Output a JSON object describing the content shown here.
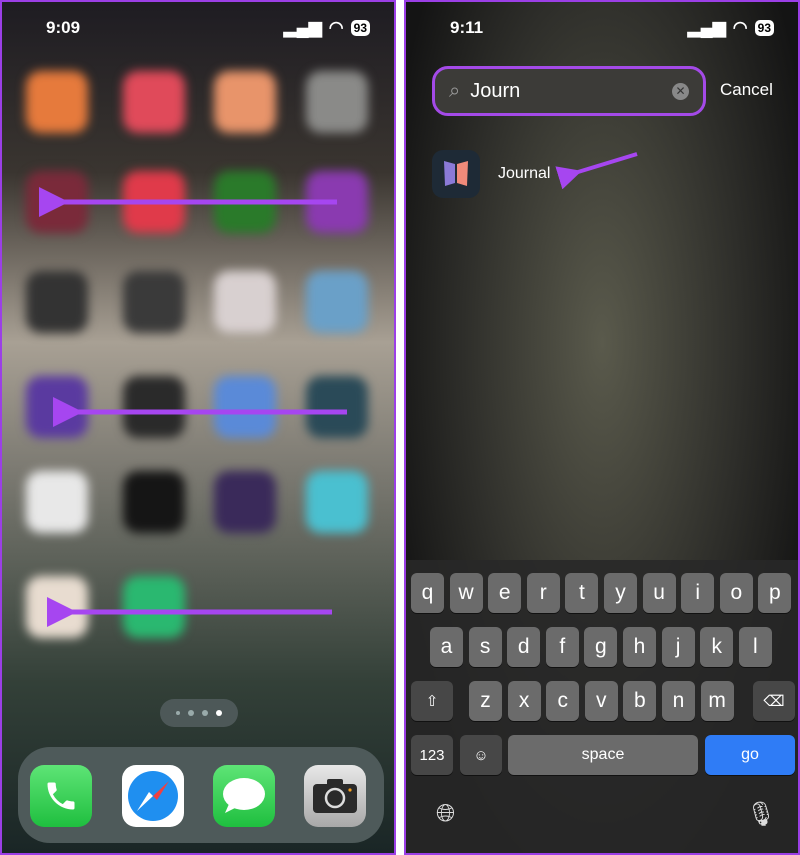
{
  "left": {
    "status": {
      "time": "9:09",
      "battery": "93"
    },
    "grid_colors": [
      [
        "#e67a3c",
        "#e04a5a",
        "#e8946a",
        "#8a8a88"
      ],
      [
        "#7a2a3a",
        "#e03a4a",
        "#2a7a2a",
        "#8a3ab0"
      ],
      [
        "#333",
        "#3a3a3a",
        "#d8d0d0",
        "#6aa0c8"
      ],
      [
        "#5a3aa0",
        "#2a2a2a",
        "#5a8ad8",
        "#2a4a58"
      ],
      [
        "#e8e8e8",
        "#151515",
        "#3a2a5a",
        "#4ac0d0"
      ],
      [
        "#e8dcd0",
        "#2ab870"
      ]
    ],
    "page_dots": 4,
    "current_page": 4,
    "dock": [
      {
        "name": "phone-app",
        "color": "#34c759"
      },
      {
        "name": "safari-app",
        "color": "#fff"
      },
      {
        "name": "messages-app",
        "color": "#34c759"
      },
      {
        "name": "camera-app",
        "color": "#c8c8c8"
      }
    ]
  },
  "right": {
    "status": {
      "time": "9:11",
      "battery": "93"
    },
    "search": {
      "value": "Journ"
    },
    "cancel": "Cancel",
    "result": {
      "label": "Journal"
    },
    "keyboard": {
      "row1": [
        "q",
        "w",
        "e",
        "r",
        "t",
        "y",
        "u",
        "i",
        "o",
        "p"
      ],
      "row2": [
        "a",
        "s",
        "d",
        "f",
        "g",
        "h",
        "j",
        "k",
        "l"
      ],
      "row3": [
        "z",
        "x",
        "c",
        "v",
        "b",
        "n",
        "m"
      ],
      "num": "123",
      "space": "space",
      "go": "go"
    }
  },
  "colors": {
    "accent": "#9b3fe6",
    "go": "#2f7cf6"
  }
}
